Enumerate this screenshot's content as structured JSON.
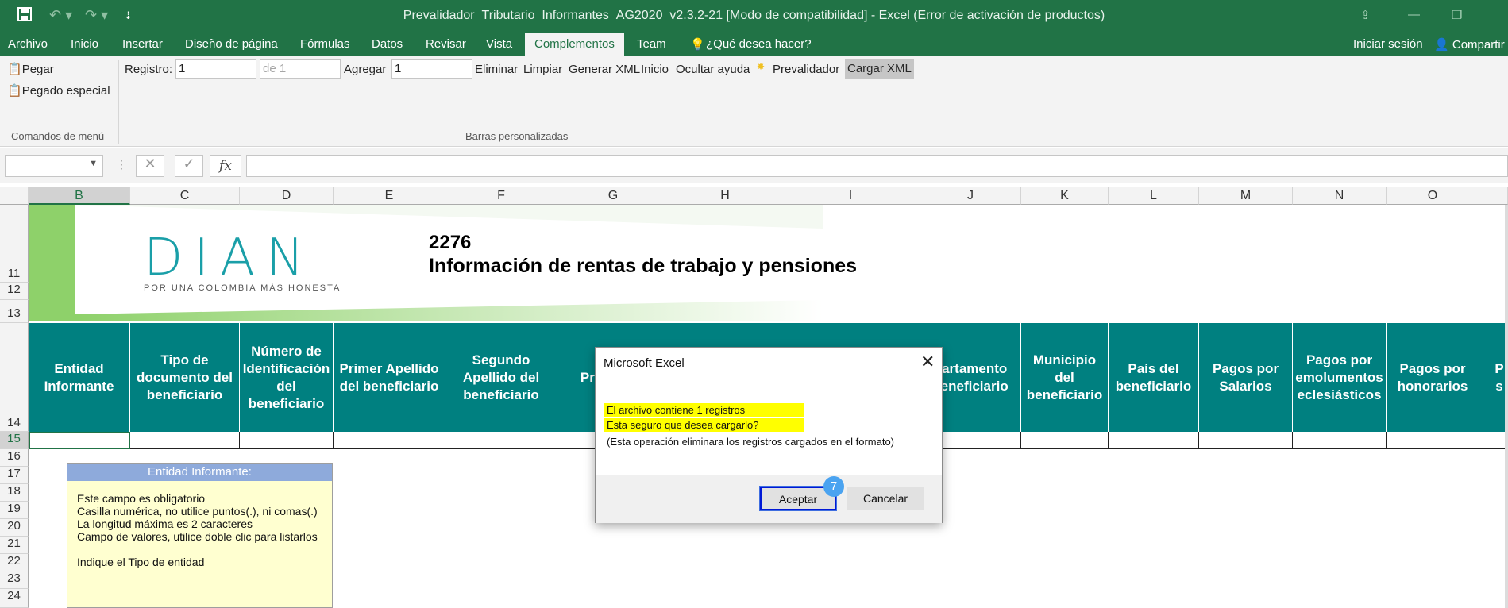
{
  "window": {
    "title": "Prevalidador_Tributario_Informantes_AG2020_v2.3.2-21  [Modo de compatibilidad] - Excel (Error de activación de productos)"
  },
  "ribbon_tabs": [
    "Archivo",
    "Inicio",
    "Insertar",
    "Diseño de página",
    "Fórmulas",
    "Datos",
    "Revisar",
    "Vista",
    "Complementos",
    "Team"
  ],
  "active_tab": "Complementos",
  "tell_me": "¿Qué desea hacer?",
  "account": {
    "signin": "Iniciar sesión",
    "share": "Compartir"
  },
  "ribbon": {
    "paste": "Pegar",
    "paste_special": "Pegado especial",
    "group_menu": "Comandos de menú",
    "registro_label": "Registro:",
    "registro_value": "1",
    "de_value": "de 1",
    "agregar_label": "Agregar",
    "agregar_value": "1",
    "eliminar": "Eliminar",
    "limpiar": "Limpiar",
    "generar_xml": "Generar XML",
    "inicio": "Inicio",
    "ocultar_ayuda": "Ocultar ayuda",
    "prevalidador": "Prevalidador",
    "cargar_xml": "Cargar XML",
    "group_custom": "Barras personalizadas"
  },
  "formula_bar": {
    "fx": "fx"
  },
  "columns": [
    "B",
    "C",
    "D",
    "E",
    "F",
    "G",
    "H",
    "I",
    "J",
    "K",
    "L",
    "M",
    "N",
    "O"
  ],
  "rows": [
    "11",
    "12",
    "13",
    "14",
    "15",
    "16",
    "17",
    "18",
    "19",
    "20",
    "21",
    "22",
    "23",
    "24"
  ],
  "banner": {
    "logo_text": "DIAN",
    "logo_tagline": "POR UNA COLOMBIA MÁS HONESTA",
    "form_number": "2276",
    "form_title": "Información de rentas de trabajo y pensiones"
  },
  "headers": [
    "Entidad Informante",
    "Tipo de documento del beneficiario",
    "Número de Identificación del beneficiario",
    "Primer Apellido del beneficiario",
    "Segundo Apellido del beneficiario",
    "Prim del b",
    "",
    "",
    "partamento beneficiario",
    "Municipio del beneficiario",
    "País del beneficiario",
    "Pagos por Salarios",
    "Pagos por emolumentos eclesiásticos",
    "Pagos por honorarios",
    "P s"
  ],
  "note": {
    "title": "Entidad Informante:",
    "lines": [
      "Este campo es obligatorio",
      "Casilla numérica, no utilice puntos(.), ni comas(.)",
      "La longitud máxima es 2 caracteres",
      "Campo de valores, utilice doble clic para listarlos",
      "",
      "Indique el Tipo de entidad"
    ]
  },
  "dialog": {
    "title": "Microsoft Excel",
    "line1": "El archivo contiene 1 registros",
    "line2": "Esta seguro que desea cargarlo?",
    "line3": "(Esta operación eliminara los registros cargados en el formato)",
    "ok": "Aceptar",
    "cancel": "Cancelar",
    "step_badge": "7"
  },
  "colors": {
    "excel_green": "#217346",
    "header_teal": "#008080",
    "highlight": "#ffff00"
  }
}
